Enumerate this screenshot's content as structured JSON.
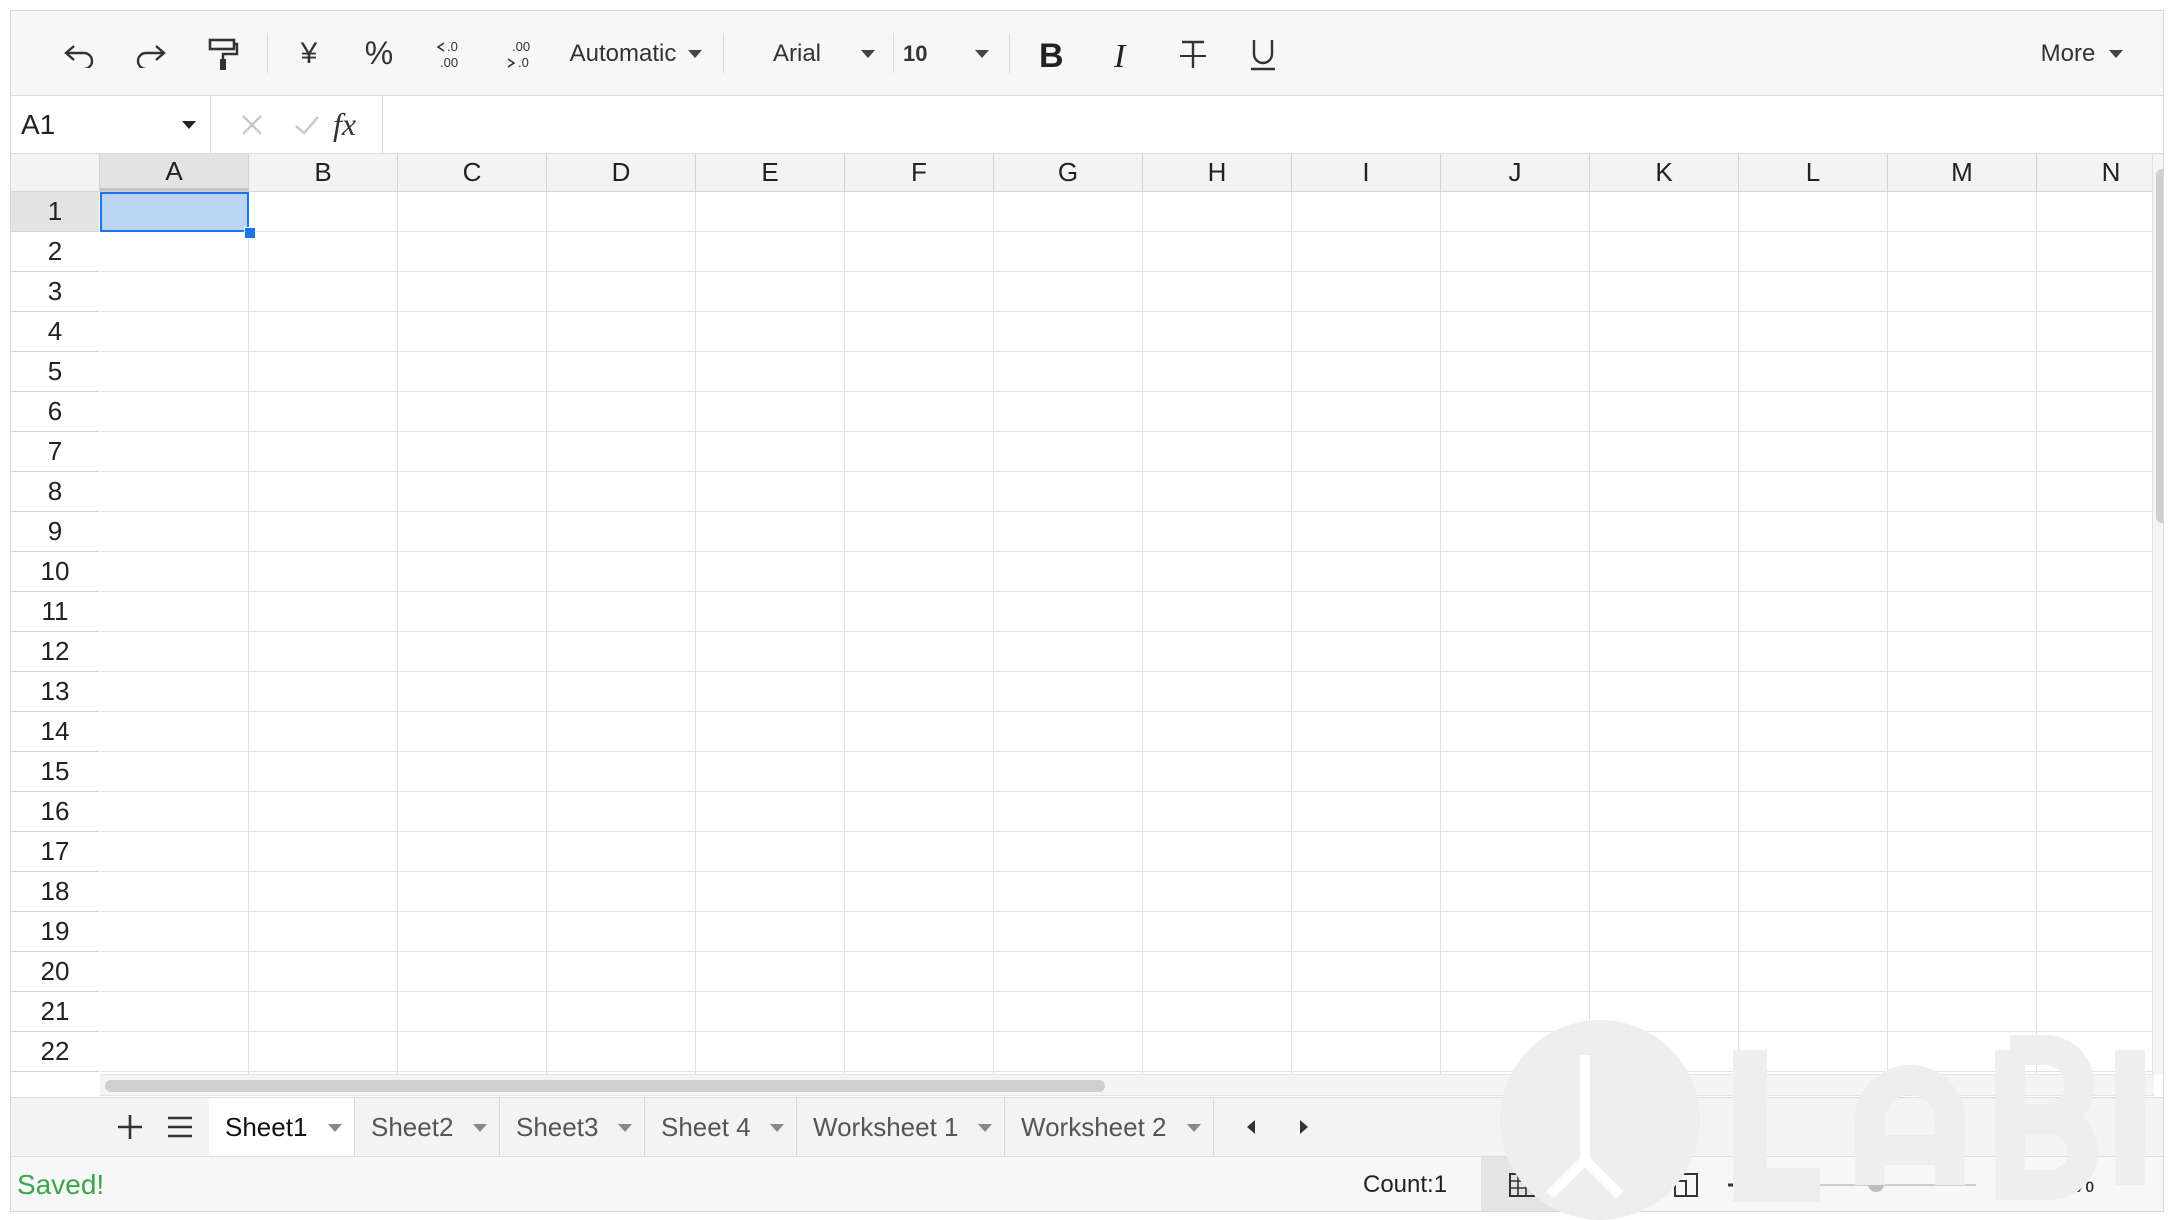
{
  "toolbar": {
    "number_format": "Automatic",
    "font_family": "Arial",
    "font_size": "10",
    "currency_symbol": "¥",
    "percent_symbol": "%",
    "more_label": "More"
  },
  "formula_bar": {
    "cell_ref": "A1",
    "fx_label": "fx",
    "value": ""
  },
  "grid": {
    "columns": [
      "A",
      "B",
      "C",
      "D",
      "E",
      "F",
      "G",
      "H",
      "I",
      "J",
      "K",
      "L",
      "M",
      "N"
    ],
    "rows": [
      "1",
      "2",
      "3",
      "4",
      "5",
      "6",
      "7",
      "8",
      "9",
      "10",
      "11",
      "12",
      "13",
      "14",
      "15",
      "16",
      "17",
      "18",
      "19",
      "20",
      "21",
      "22"
    ],
    "active_cell": "A1"
  },
  "sheets": {
    "tabs": [
      "Sheet1",
      "Sheet2",
      "Sheet3",
      "Sheet 4",
      "Worksheet 1",
      "Worksheet 2"
    ],
    "active": "Sheet1"
  },
  "status": {
    "saved": "Saved!",
    "count": "Count:1",
    "zoom": "100%",
    "saved_color": "#3aa64a"
  },
  "selection_color": "#1a73e8"
}
